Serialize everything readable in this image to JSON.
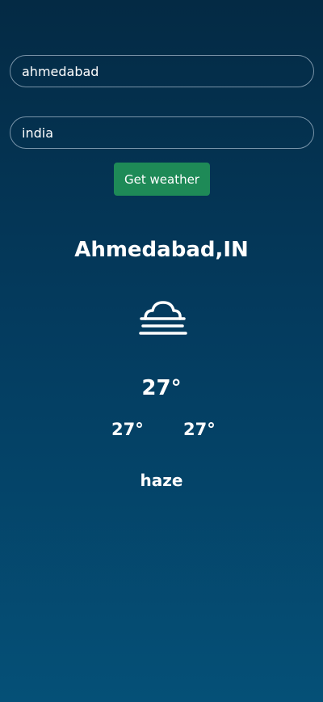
{
  "form": {
    "city_value": "ahmedabad",
    "country_value": "india",
    "button_label": "Get weather"
  },
  "weather": {
    "location": "Ahmedabad,IN",
    "icon": "haze-icon",
    "temperature": "27°",
    "temp_min": "27°",
    "temp_max": "27°",
    "condition": "haze"
  }
}
